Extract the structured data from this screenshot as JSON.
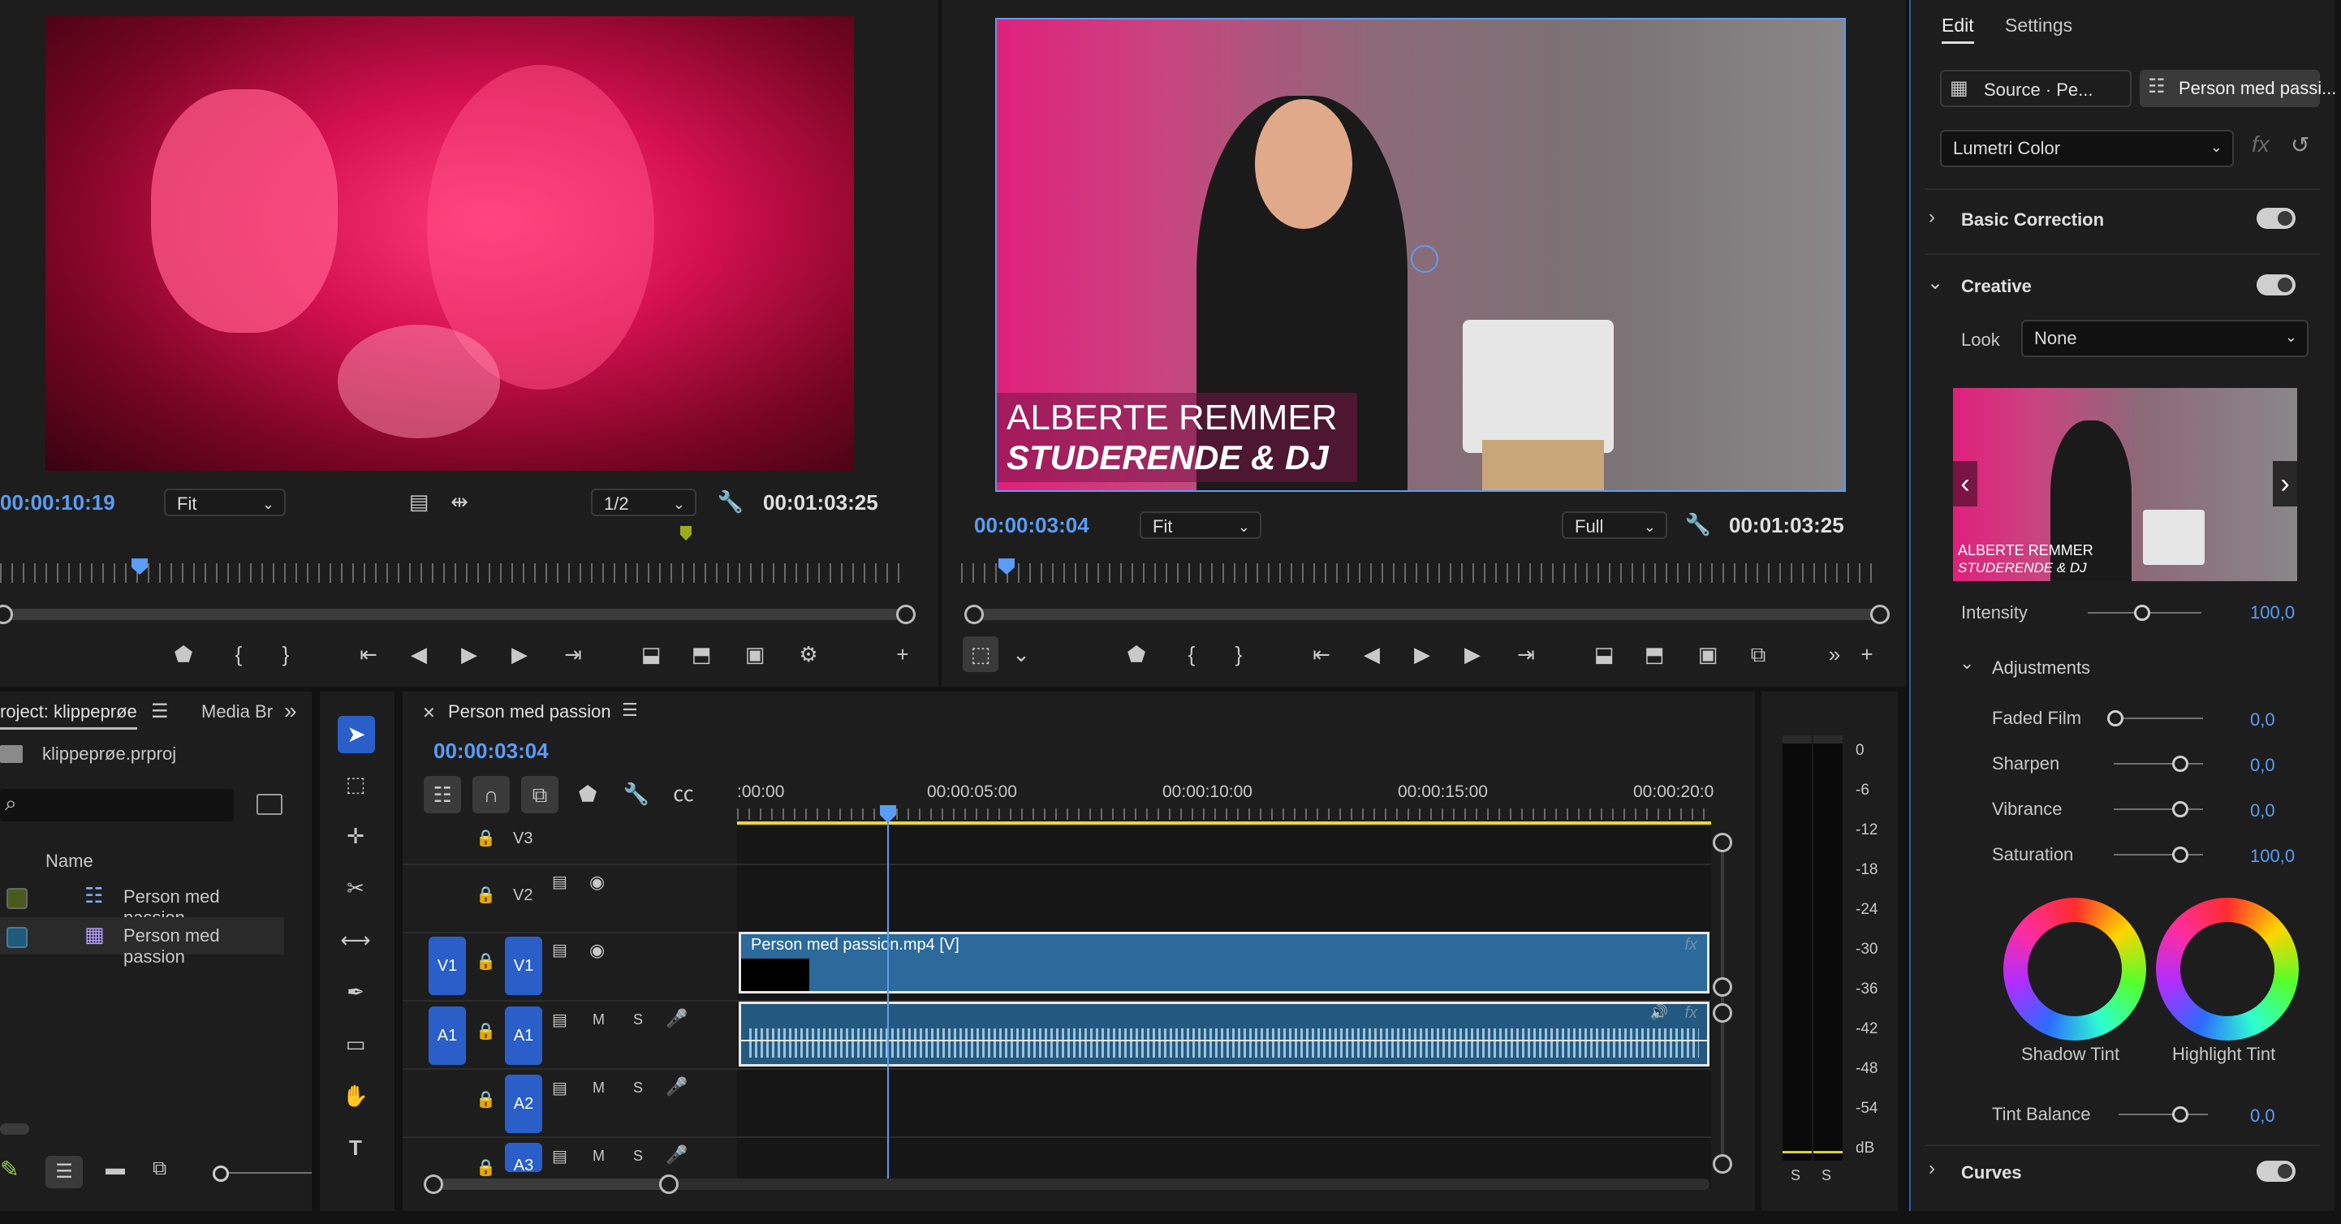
{
  "source_monitor": {
    "timecode": "00:00:10:19",
    "zoom": "Fit",
    "resolution": "1/2",
    "duration": "00:01:03:25"
  },
  "program_monitor": {
    "timecode": "00:00:03:04",
    "zoom": "Fit",
    "resolution": "Full",
    "duration": "00:01:03:25",
    "lower_third_name": "ALBERTE REMMER",
    "lower_third_title": "STUDERENDE & DJ"
  },
  "project": {
    "tab_project": "roject: klippeprøe",
    "tab_media": "Media Br",
    "file": "klippeprøe.prproj",
    "column_name": "Name",
    "items": [
      {
        "name": "Person med passion",
        "swatch": "#4a5a1e"
      },
      {
        "name": "Person med passion",
        "swatch": "#1f5a7a"
      }
    ]
  },
  "timeline": {
    "title": "Person med passion",
    "timecode": "00:00:03:04",
    "ruler": [
      ":00:00",
      "00:00:05:00",
      "00:00:10:00",
      "00:00:15:00",
      "00:00:20:0"
    ],
    "tracks": {
      "v3": "V3",
      "v2": "V2",
      "v1_src": "V1",
      "v1": "V1",
      "a1_src": "A1",
      "a1": "A1",
      "a2": "A2",
      "a3": "A3",
      "m": "M",
      "s": "S"
    },
    "clip_label": "Person med passion.mp4 [V]",
    "fx": "fx"
  },
  "meter": {
    "scale": [
      "0",
      "-6",
      "-12",
      "-18",
      "-24",
      "-30",
      "-36",
      "-42",
      "-48",
      "-54",
      "dB"
    ],
    "solo": [
      "S",
      "S"
    ]
  },
  "lumetri": {
    "tab_edit": "Edit",
    "tab_settings": "Settings",
    "source_btn": "Source · Pe...",
    "sequence_btn": "Person med passi...",
    "effect": "Lumetri Color",
    "basic_correction": "Basic Correction",
    "creative": "Creative",
    "look_label": "Look",
    "look_value": "None",
    "thumb_name": "ALBERTE REMMER",
    "thumb_title": "STUDERENDE & DJ",
    "intensity_label": "Intensity",
    "intensity_value": "100,0",
    "intensity_level": 0.48,
    "adjustments": "Adjustments",
    "sliders": [
      {
        "label": "Faded Film",
        "value": "0,0"
      },
      {
        "label": "Sharpen",
        "value": "0,0"
      },
      {
        "label": "Vibrance",
        "value": "0,0"
      },
      {
        "label": "Saturation",
        "value": "100,0"
      }
    ],
    "shadow_tint": "Shadow Tint",
    "highlight_tint": "Highlight Tint",
    "tint_balance_label": "Tint Balance",
    "tint_balance_value": "0,0",
    "curves": "Curves"
  }
}
